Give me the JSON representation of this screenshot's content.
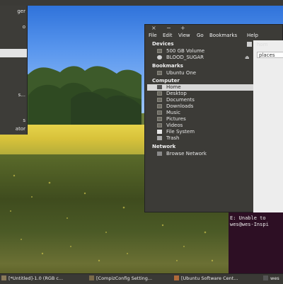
{
  "menu": {
    "items": [
      "ger",
      "o",
      "",
      "",
      "s...",
      "",
      "s",
      "ator"
    ]
  },
  "file_manager": {
    "title_buttons": [
      "×",
      "−",
      "+"
    ],
    "menubar": [
      "File",
      "Edit",
      "View",
      "Go",
      "Bookmarks",
      "Help"
    ],
    "path": "hom",
    "tab": "places",
    "sections": {
      "devices": "Devices",
      "bookmarks": "Bookmarks",
      "computer": "Computer",
      "network": "Network"
    },
    "devices": [
      "500 GB Volume",
      "BLOOD_SUGAR"
    ],
    "bookmarks": [
      "Ubuntu One"
    ],
    "computer": [
      "Home",
      "Desktop",
      "Documents",
      "Downloads",
      "Music",
      "Pictures",
      "Videos",
      "File System",
      "Trash"
    ],
    "network": [
      "Browse Network"
    ],
    "selected": "Home"
  },
  "terminal": {
    "lines": [
      "E: Unable to",
      "wes@wes-Inspi"
    ]
  },
  "taskbar": {
    "items": [
      "[*Untitled]-1.0 (RGB c...",
      "[CompizConfig Setting...",
      "[Ubuntu Software Cent...",
      "wes"
    ]
  }
}
